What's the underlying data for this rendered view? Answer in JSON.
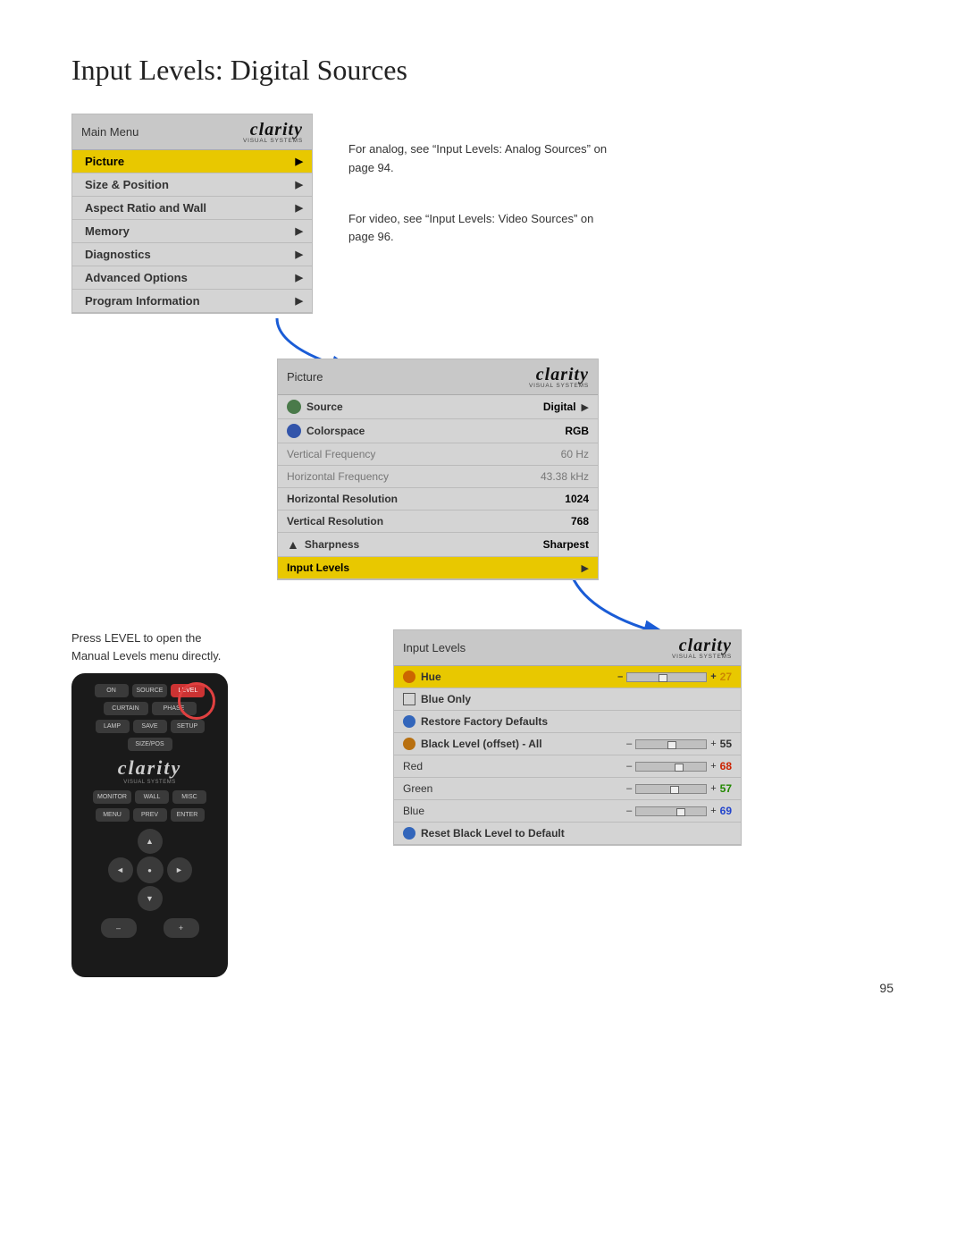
{
  "page": {
    "title": "Input Levels: Digital Sources",
    "page_number": "95"
  },
  "main_menu": {
    "header_label": "Main Menu",
    "items": [
      {
        "label": "Picture",
        "highlighted": true,
        "has_arrow": true
      },
      {
        "label": "Size & Position",
        "highlighted": false,
        "has_arrow": true
      },
      {
        "label": "Aspect Ratio and Wall",
        "highlighted": false,
        "has_arrow": true
      },
      {
        "label": "Memory",
        "highlighted": false,
        "has_arrow": true
      },
      {
        "label": "Diagnostics",
        "highlighted": false,
        "has_arrow": true
      },
      {
        "label": "Advanced Options",
        "highlighted": false,
        "has_arrow": true
      },
      {
        "label": "Program Information",
        "highlighted": false,
        "has_arrow": true
      }
    ]
  },
  "notes": {
    "analog_note": "For analog, see “Input Levels: Analog Sources” on page 94.",
    "video_note": "For video, see “Input Levels: Video Sources” on page 96.",
    "press_note_line1": "Press LEVEL to open the",
    "press_note_line2": "Manual Levels menu directly."
  },
  "picture_menu": {
    "header_label": "Picture",
    "items": [
      {
        "label": "Source",
        "value": "Digital",
        "has_arrow": true,
        "icon": "source-icon",
        "bold": true,
        "dimmed": false
      },
      {
        "label": "Colorspace",
        "value": "RGB",
        "has_arrow": false,
        "icon": "colorspace-icon",
        "bold": true,
        "dimmed": false
      },
      {
        "label": "Vertical Frequency",
        "value": "60 Hz",
        "has_arrow": false,
        "icon": null,
        "bold": false,
        "dimmed": true
      },
      {
        "label": "Horizontal Frequency",
        "value": "43.38 kHz",
        "has_arrow": false,
        "icon": null,
        "bold": false,
        "dimmed": true
      },
      {
        "label": "Horizontal Resolution",
        "value": "1024",
        "has_arrow": false,
        "icon": null,
        "bold": true,
        "dimmed": false
      },
      {
        "label": "Vertical Resolution",
        "value": "768",
        "has_arrow": false,
        "icon": null,
        "bold": true,
        "dimmed": false
      },
      {
        "label": "Sharpness",
        "value": "Sharpest",
        "has_arrow": false,
        "icon": "sharpness-icon",
        "bold": true,
        "dimmed": false
      },
      {
        "label": "Input Levels",
        "value": "",
        "has_arrow": true,
        "icon": null,
        "bold": true,
        "dimmed": false,
        "highlighted": true
      }
    ]
  },
  "input_levels_menu": {
    "header_label": "Input Levels",
    "items": [
      {
        "label": "Hue",
        "icon": "hue-icon",
        "has_slider": true,
        "value": "27",
        "highlighted": true,
        "slider_pos": 0.45
      },
      {
        "label": "Blue Only",
        "icon": "blue-only-icon",
        "has_slider": false,
        "value": "",
        "highlighted": false
      },
      {
        "label": "Restore Factory Defaults",
        "icon": "restore-icon",
        "has_slider": false,
        "value": "",
        "highlighted": false
      },
      {
        "label": "Black Level (offset) - All",
        "icon": "blacklevel-icon",
        "has_slider": true,
        "value": "55",
        "highlighted": false,
        "slider_pos": 0.5
      },
      {
        "label": "Red",
        "icon": null,
        "has_slider": true,
        "value": "68",
        "highlighted": false,
        "slider_pos": 0.6,
        "value_color": "red"
      },
      {
        "label": "Green",
        "icon": null,
        "has_slider": true,
        "value": "57",
        "highlighted": false,
        "slider_pos": 0.52,
        "value_color": "green"
      },
      {
        "label": "Blue",
        "icon": null,
        "has_slider": true,
        "value": "69",
        "highlighted": false,
        "slider_pos": 0.62,
        "value_color": "blue"
      },
      {
        "label": "Reset Black Level to Default",
        "icon": "reset-icon",
        "has_slider": false,
        "value": "",
        "highlighted": false
      }
    ]
  },
  "remote": {
    "buttons": [
      [
        "ON",
        "SOURCE",
        "LEVEL"
      ],
      [
        "CURTAIN",
        "PHASE"
      ],
      [
        "LAMP",
        "SAVE",
        "SETUP"
      ],
      [
        "SIZE/POS"
      ],
      [
        "MONITOR",
        "WALL",
        "MISC"
      ],
      [
        "MENU",
        "PREV",
        "ENTER"
      ]
    ],
    "nav": [
      "▲",
      "◄",
      "●",
      "►",
      "▼"
    ],
    "bottom_btns": [
      "–",
      "+"
    ]
  }
}
